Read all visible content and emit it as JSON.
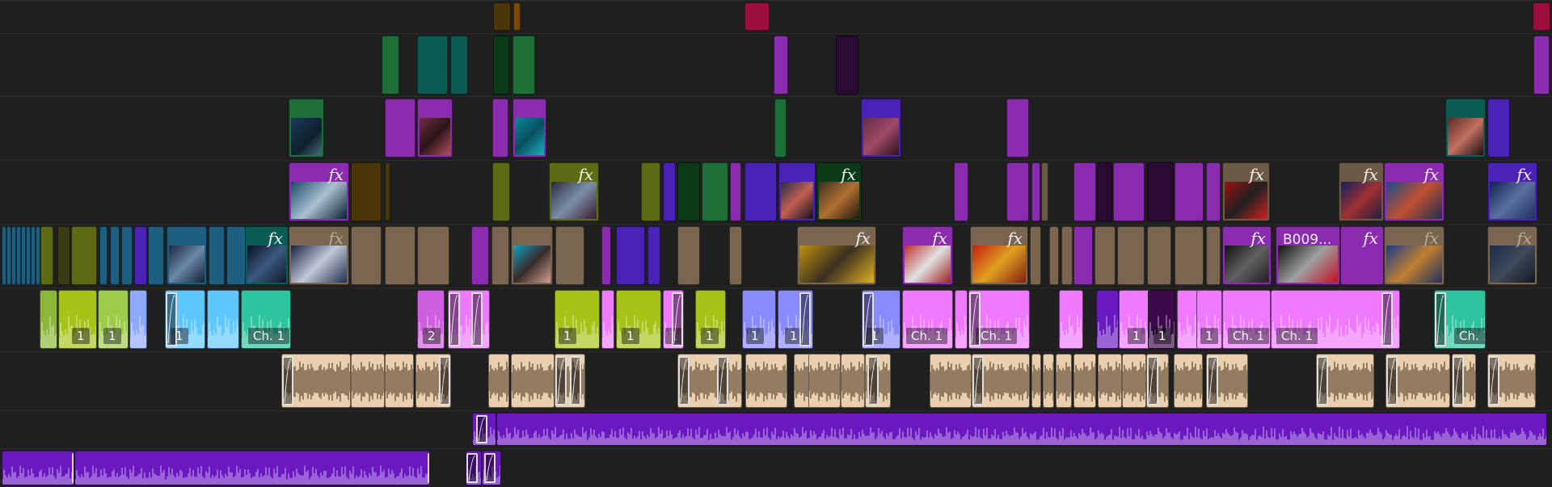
{
  "app": {
    "name": "Video editor timeline",
    "view": "multitrack"
  },
  "tracks": [
    {
      "id": "V6",
      "kind": "video"
    },
    {
      "id": "V5",
      "kind": "video"
    },
    {
      "id": "V4",
      "kind": "video"
    },
    {
      "id": "V3",
      "kind": "video"
    },
    {
      "id": "V2",
      "kind": "video"
    },
    {
      "id": "A1",
      "kind": "audio"
    },
    {
      "id": "A2",
      "kind": "audio"
    },
    {
      "id": "A3",
      "kind": "audio"
    },
    {
      "id": "A4",
      "kind": "audio"
    }
  ],
  "labels": {
    "fx": "fx",
    "ch1": "Ch. 1",
    "one": "1",
    "two": "2",
    "b009": "B009..."
  },
  "colors": {
    "background": "#1c1c1c",
    "purple": "#8a2bb0",
    "violet": "#4b22b8",
    "tan": "#7a6650",
    "olive": "#5e6a14",
    "green": "#1e6e38",
    "teal": "#0a5c55",
    "blue": "#1c5f80",
    "crimson": "#9a0f3b",
    "audio_purple": "#6a18c0",
    "audio_tan": "#e9cfae"
  }
}
